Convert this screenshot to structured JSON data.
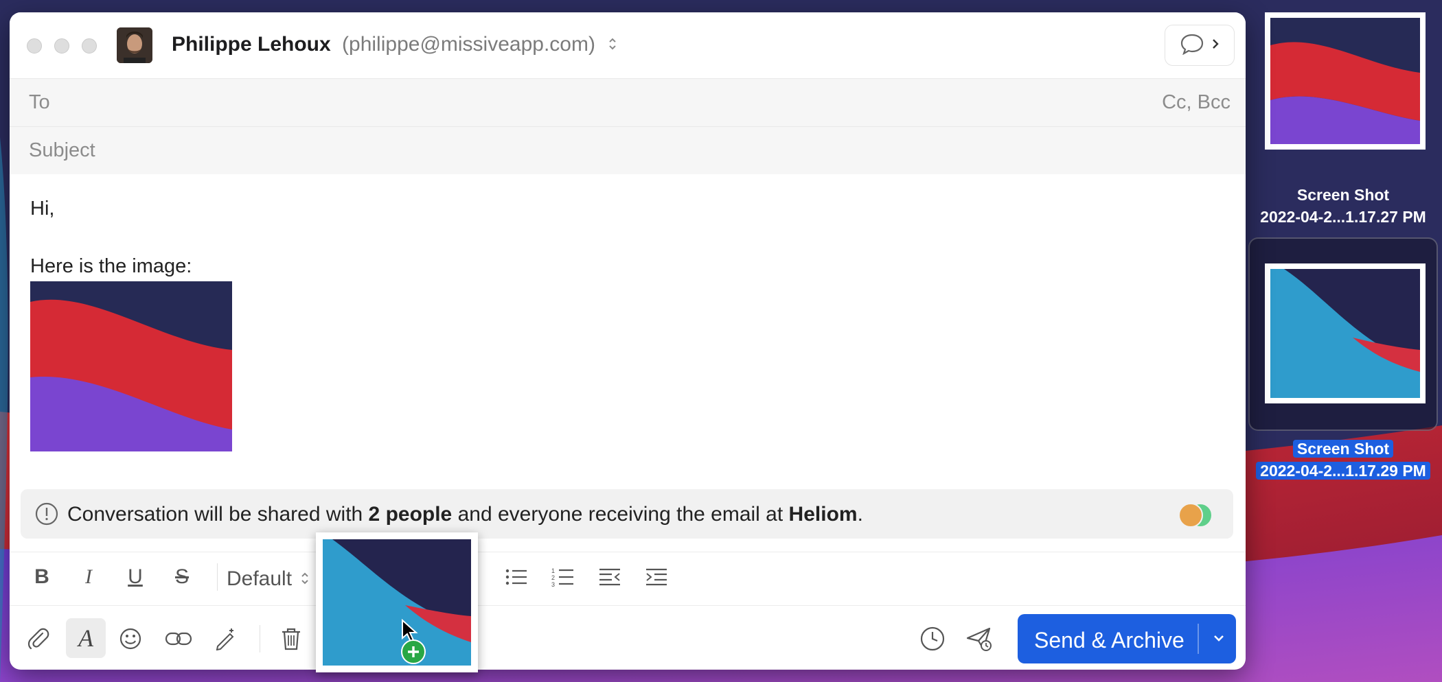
{
  "compose": {
    "sender_name": "Philippe Lehoux",
    "sender_email": "(philippe@missiveapp.com)",
    "to_label": "To",
    "cc_bcc_label": "Cc, Bcc",
    "subject_placeholder": "Subject",
    "body_greeting": "Hi,",
    "body_line": "Here is the image:"
  },
  "share_notice": {
    "prefix": "Conversation will be shared with ",
    "count": "2 people",
    "middle": " and everyone receiving the email at ",
    "org": "Heliom",
    "suffix": "."
  },
  "format_toolbar": {
    "bold": "B",
    "italic": "I",
    "underline": "U",
    "strike": "S",
    "font": "Default"
  },
  "action_toolbar": {
    "send_label": "Send & Archive"
  },
  "desktop_files": [
    {
      "line1": "Screen Shot",
      "line2": "2022-04-2...1.17.27 PM",
      "selected": false
    },
    {
      "line1": "Screen Shot",
      "line2": "2022-04-2...1.17.29 PM",
      "selected": true
    }
  ],
  "colors": {
    "accent": "#1d5fe0",
    "plus_badge": "#28a745"
  }
}
